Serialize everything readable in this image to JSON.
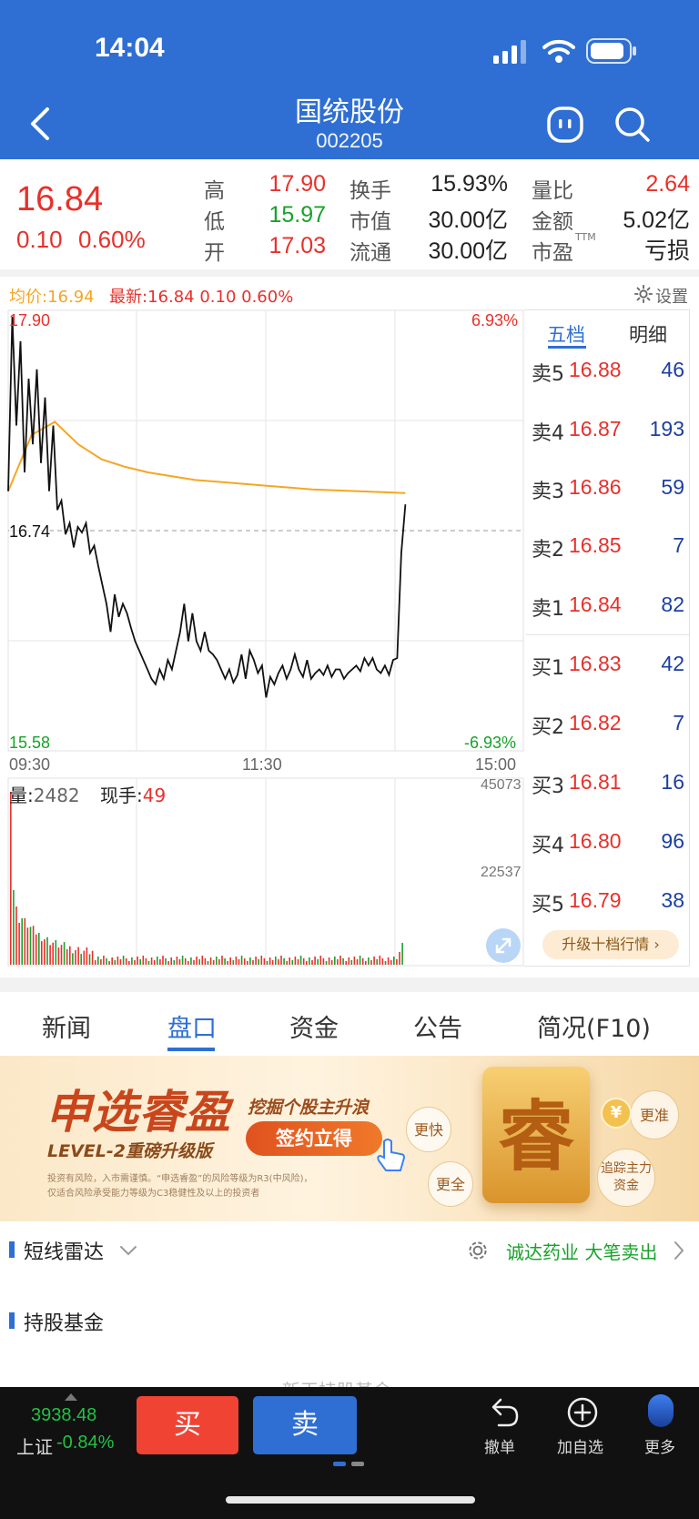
{
  "status": {
    "time": "14:04"
  },
  "header": {
    "title": "国统股份",
    "code": "002205"
  },
  "quote": {
    "price": "16.84",
    "change": "0.10",
    "change_pct": "0.60%",
    "high_label": "高",
    "high": "17.90",
    "low_label": "低",
    "low": "15.97",
    "open_label": "开",
    "open": "17.03",
    "turnover_label": "换手",
    "turnover": "15.93%",
    "mktcap_label": "市值",
    "mktcap": "30.00亿",
    "float_label": "流通",
    "float": "30.00亿",
    "volratio_label": "量比",
    "volratio": "2.64",
    "amount_label": "金额",
    "amount": "5.02亿",
    "pe_label": "市盈",
    "pe_sup": "TTM",
    "pe": "亏损"
  },
  "chart_info": {
    "avg_text": "均价:16.94",
    "latest_text": "最新:16.84 0.10 0.60%",
    "settings": "设置",
    "top_price": "17.90",
    "top_pct": "6.93%",
    "mid_price": "16.74",
    "bottom_price": "15.58",
    "bottom_pct": "-6.93%",
    "time_start": "09:30",
    "time_mid": "11:30",
    "time_end": "15:00",
    "vol_label": "量:",
    "vol_value": "2482",
    "hand_label": "现手:",
    "hand_value": "49",
    "vol_max": "45073",
    "vol_mid": "22537"
  },
  "chart_data": {
    "type": "line",
    "title": "",
    "ylim": [
      15.58,
      17.9
    ],
    "x_range": [
      "09:30",
      "15:00"
    ],
    "series": [
      {
        "name": "最新",
        "values": [
          16.95,
          17.88,
          17.3,
          17.75,
          17.05,
          17.55,
          17.2,
          17.6,
          17.1,
          17.45,
          16.95,
          17.3,
          16.85,
          16.9,
          16.72,
          16.78,
          16.65,
          16.76,
          16.73,
          16.78,
          16.62,
          16.66,
          16.55,
          16.45,
          16.35,
          16.2,
          16.4,
          16.28,
          16.35,
          16.3,
          16.22,
          16.15,
          16.1,
          16.05,
          16.0,
          15.95,
          15.92,
          16.0,
          15.95,
          16.05,
          16.0,
          16.1,
          16.2,
          16.35,
          16.15,
          16.3,
          16.15,
          16.1,
          16.2,
          16.1,
          16.08,
          16.05,
          16.0,
          15.95,
          16.0,
          15.93,
          15.97,
          16.08,
          15.95,
          16.1,
          16.05,
          15.98,
          16.02,
          15.85,
          15.96,
          15.92,
          15.98,
          16.02,
          15.95,
          16.0,
          16.08,
          16.0,
          15.96,
          16.05,
          15.95,
          15.98,
          16.0,
          15.97,
          16.02,
          15.96,
          16.0,
          16.0,
          15.95,
          15.98,
          16.0,
          16.02,
          15.99,
          16.06,
          16.02,
          16.06,
          16.0,
          15.98,
          16.02,
          15.97,
          16.05,
          16.06,
          16.62,
          16.88
        ]
      },
      {
        "name": "均价",
        "values": [
          16.95,
          17.25,
          17.32,
          17.2,
          17.12,
          17.08,
          17.05,
          17.03,
          17.01,
          17.0,
          16.99,
          16.98,
          16.97,
          16.96,
          16.955,
          16.95,
          16.945,
          16.94
        ]
      }
    ],
    "volume": {
      "max": 45073,
      "mid": 22537
    }
  },
  "orderbook": {
    "tab_five": "五档",
    "tab_detail": "明细",
    "asks": [
      {
        "label": "卖5",
        "price": "16.88",
        "vol": "46"
      },
      {
        "label": "卖4",
        "price": "16.87",
        "vol": "193"
      },
      {
        "label": "卖3",
        "price": "16.86",
        "vol": "59"
      },
      {
        "label": "卖2",
        "price": "16.85",
        "vol": "7"
      },
      {
        "label": "卖1",
        "price": "16.84",
        "vol": "82"
      }
    ],
    "bids": [
      {
        "label": "买1",
        "price": "16.83",
        "vol": "42"
      },
      {
        "label": "买2",
        "price": "16.82",
        "vol": "7"
      },
      {
        "label": "买3",
        "price": "16.81",
        "vol": "16"
      },
      {
        "label": "买4",
        "price": "16.80",
        "vol": "96"
      },
      {
        "label": "买5",
        "price": "16.79",
        "vol": "38"
      }
    ],
    "upgrade": "升级十档行情 ›"
  },
  "tabs": {
    "news": "新闻",
    "pankou": "盘口",
    "funds": "资金",
    "notice": "公告",
    "profile": "简况(F10)"
  },
  "banner": {
    "brand": "申选睿盈",
    "sub": "LEVEL-2重磅升级版",
    "slogan": "挖掘个股主升浪",
    "cta": "签约立得",
    "disclaimer1": "投资有风险，入市需谨慎。“申选睿盈”的风险等级为R3(中风险)，",
    "disclaimer2": "仅适合风险承受能力等级为C3稳健性及以上的投资者",
    "big_char": "睿",
    "bubble1": "更快",
    "bubble2": "更准",
    "bubble3": "更全",
    "bubble4": "追踪主力资金"
  },
  "radar": {
    "title": "短线雷达",
    "alert": "诚达药业 大笔卖出"
  },
  "funds_section": {
    "title": "持股基金",
    "partial": "新天持股基金"
  },
  "footer": {
    "index_value": "3938.48",
    "index_name": "上证",
    "index_change": "-0.84%",
    "buy": "买",
    "sell": "卖",
    "cancel": "撤单",
    "add_watch": "加自选",
    "more": "更多"
  },
  "colors": {
    "header": "#2f6fd3",
    "up": "#e8302a",
    "down": "#17a22a",
    "avg_line": "#f5a623"
  }
}
